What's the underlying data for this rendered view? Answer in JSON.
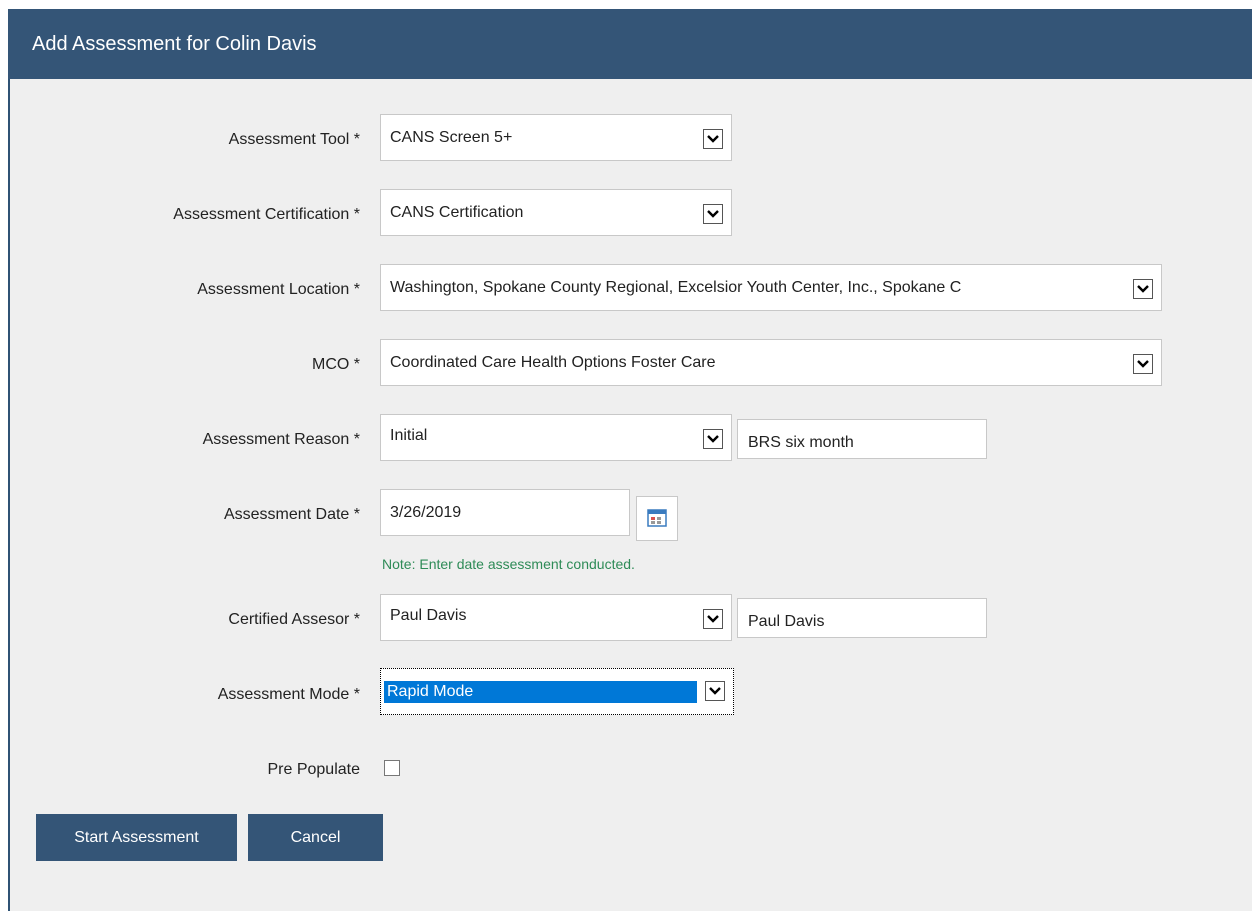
{
  "dialog": {
    "title": "Add Assessment for Colin Davis"
  },
  "form": {
    "assessment_tool": {
      "label": "Assessment Tool *",
      "value": "CANS Screen 5+"
    },
    "assessment_certification": {
      "label": "Assessment Certification *",
      "value": "CANS Certification"
    },
    "assessment_location": {
      "label": "Assessment Location *",
      "value": "Washington, Spokane County Regional, Excelsior Youth Center, Inc., Spokane C"
    },
    "mco": {
      "label": "MCO *",
      "value": "Coordinated Care Health Options Foster Care"
    },
    "assessment_reason": {
      "label": "Assessment Reason *",
      "value": "Initial",
      "detail": "BRS six month"
    },
    "assessment_date": {
      "label": "Assessment Date *",
      "value": "3/26/2019",
      "note": "Note: Enter date assessment conducted."
    },
    "certified_assessor": {
      "label": "Certified Assesor *",
      "value": "Paul Davis",
      "detail": "Paul Davis"
    },
    "assessment_mode": {
      "label": "Assessment Mode *",
      "value": "Rapid Mode"
    },
    "pre_populate": {
      "label": "Pre Populate",
      "checked": false
    }
  },
  "buttons": {
    "start": "Start Assessment",
    "cancel": "Cancel"
  },
  "colors": {
    "header": "#345577",
    "note": "#2e8b57",
    "selection": "#0078d7"
  }
}
